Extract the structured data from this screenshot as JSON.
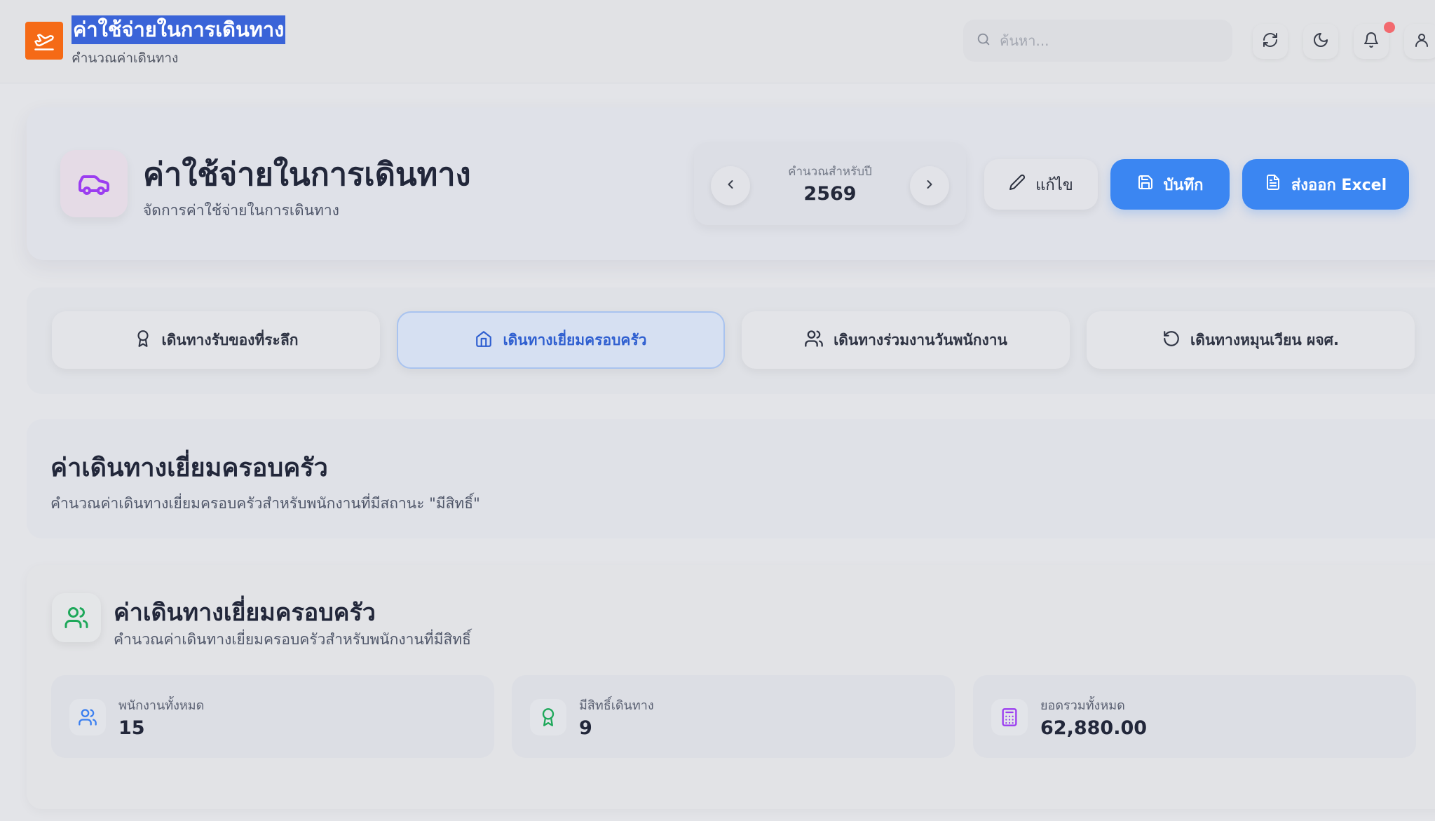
{
  "app": {
    "title": "ค่าใช้จ่ายในการเดินทาง",
    "subtitle": "คำนวณค่าเดินทาง",
    "logo_icon": "plane-takeoff-icon",
    "brand_color": "#f56a16"
  },
  "header": {
    "search_placeholder": "ค้นหา...",
    "buttons": [
      "refresh-icon",
      "moon-icon",
      "bell-icon",
      "user-icon"
    ],
    "notification_dot_color": "#f26a6f"
  },
  "page": {
    "title": "ค่าใช้จ่ายในการเดินทาง",
    "subtitle": "จัดการค่าใช้จ่ายในการเดินทาง",
    "icon": "car-icon",
    "icon_color": "#9b3df0"
  },
  "year_selector": {
    "label": "คำนวณสำหรับปี",
    "value": "2569"
  },
  "actions": {
    "edit_label": "แก้ไข",
    "save_label": "บันทึก",
    "export_label": "ส่งออก Excel",
    "accent_color": "#3b86f2"
  },
  "tabs": [
    {
      "label": "เดินทางรับของที่ระลึก",
      "icon": "award-icon",
      "active": false
    },
    {
      "label": "เดินทางเยี่ยมครอบครัว",
      "icon": "home-icon",
      "active": true
    },
    {
      "label": "เดินทางร่วมงานวันพนักงาน",
      "icon": "users-icon",
      "active": false
    },
    {
      "label": "เดินทางหมุนเวียน ผจศ.",
      "icon": "rotate-ccw-icon",
      "active": false
    }
  ],
  "section": {
    "title": "ค่าเดินทางเยี่ยมครอบครัว",
    "description": "คำนวณค่าเดินทางเยี่ยมครอบครัวสำหรับพนักงานที่มีสถานะ \"มีสิทธิ์\""
  },
  "summary": {
    "title": "ค่าเดินทางเยี่ยมครอบครัว",
    "description": "คำนวณค่าเดินทางเยี่ยมครอบครัวสำหรับพนักงานที่มีสิทธิ์",
    "icon": "users-icon",
    "stats": [
      {
        "label": "พนักงานทั้งหมด",
        "value": "15",
        "icon": "users-icon",
        "color": "#3b7ff0"
      },
      {
        "label": "มีสิทธิ์เดินทาง",
        "value": "9",
        "icon": "award-icon",
        "color": "#1ea85a"
      },
      {
        "label": "ยอดรวมทั้งหมด",
        "value": "62,880.00",
        "icon": "calculator-icon",
        "color": "#9b3df0"
      }
    ]
  }
}
